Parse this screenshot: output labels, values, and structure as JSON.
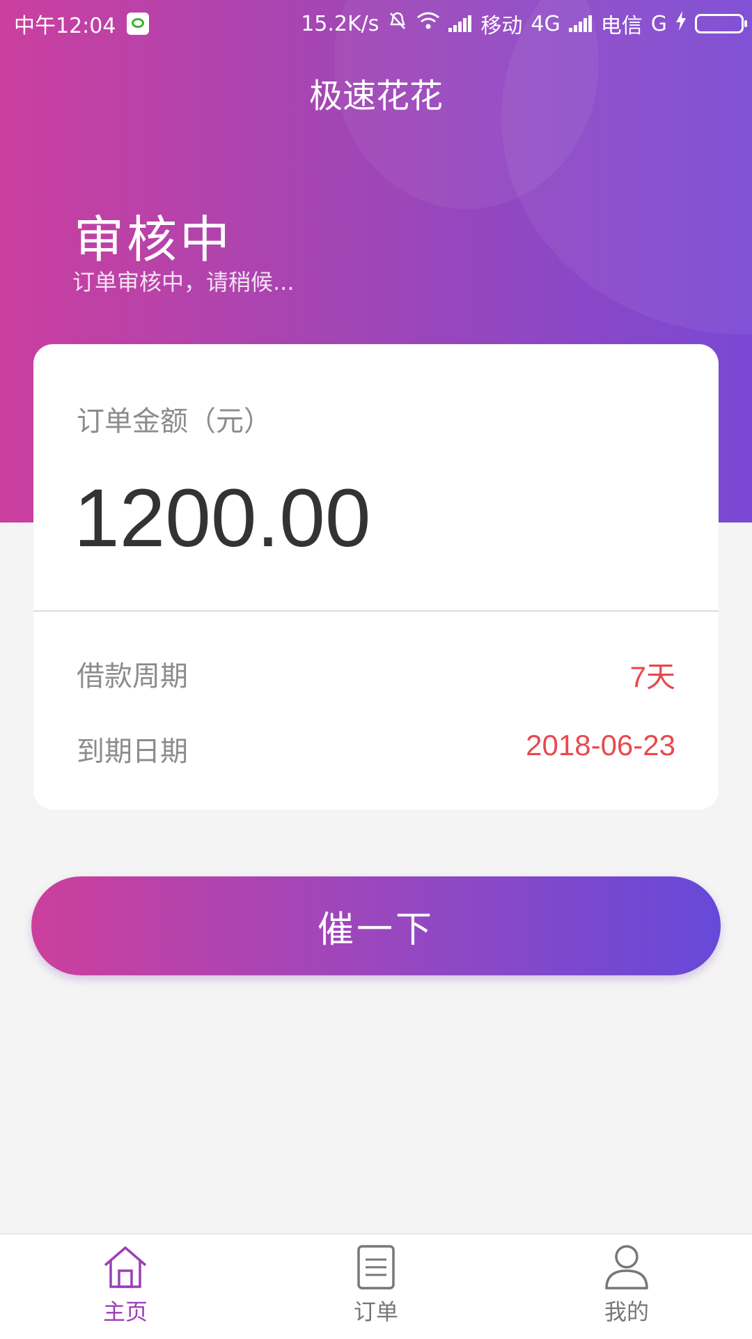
{
  "status_bar": {
    "time": "中午12:04",
    "speed": "15.2K/s",
    "carrier1": "移动",
    "network1": "4G",
    "carrier2": "电信",
    "network2": "G"
  },
  "app": {
    "title": "极速花花"
  },
  "status": {
    "heading": "审核中",
    "subtitle": "订单审核中，请稍候..."
  },
  "order": {
    "amount_label": "订单金额（元）",
    "amount": "1200.00",
    "rows": [
      {
        "label": "借款周期",
        "value": "7天"
      },
      {
        "label": "到期日期",
        "value": "2018-06-23"
      }
    ]
  },
  "action": {
    "urge_label": "催一下"
  },
  "tabbar": {
    "tabs": [
      {
        "label": "主页",
        "icon": "home-icon",
        "active": true
      },
      {
        "label": "订单",
        "icon": "document-icon",
        "active": false
      },
      {
        "label": "我的",
        "icon": "user-icon",
        "active": false
      }
    ]
  },
  "colors": {
    "accent_start": "#cb3f9f",
    "accent_end": "#6649d9",
    "highlight_value": "#e8494f",
    "tab_active": "#9b3fb8"
  }
}
